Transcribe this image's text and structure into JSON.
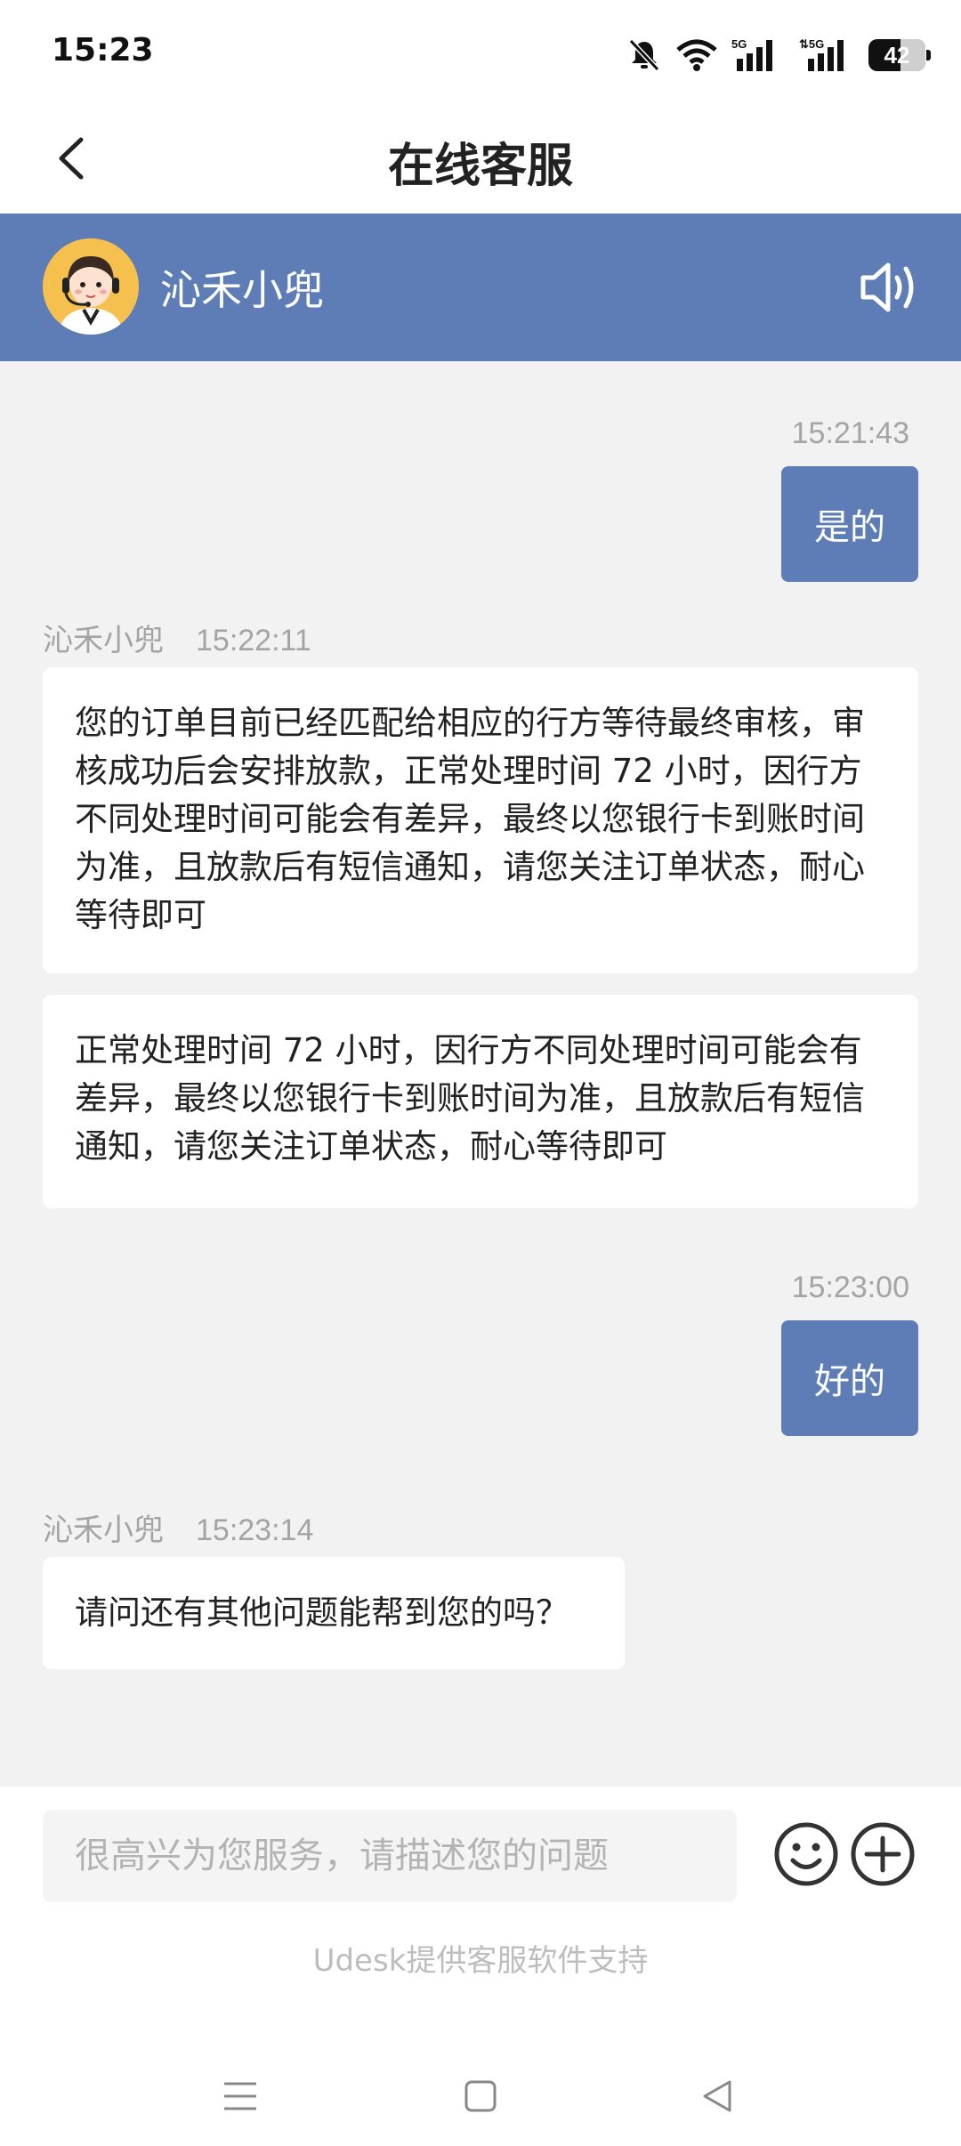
{
  "status_bar": {
    "time": "15:23",
    "battery": "42",
    "icons": [
      "mute-bell-icon",
      "wifi-icon",
      "5g-signal-icon",
      "5g-signal-icon",
      "battery-icon"
    ]
  },
  "header": {
    "title": "在线客服",
    "back_icon": "back-chevron-icon"
  },
  "agent": {
    "name": "沁禾小兜",
    "avatar_icon": "agent-avatar",
    "speaker_icon": "speaker-icon"
  },
  "messages": [
    {
      "direction": "out",
      "time": "15:21:43",
      "text": "是的"
    },
    {
      "direction": "in",
      "sender": "沁禾小兜",
      "time": "15:22:11",
      "text": "您的订单目前已经匹配给相应的行方等待最终审核，审核成功后会安排放款，正常处理时间 72 小时，因行方不同处理时间可能会有差异，最终以您银行卡到账时间为准，且放款后有短信通知，请您关注订单状态，耐心等待即可"
    },
    {
      "direction": "in",
      "text": "正常处理时间 72 小时，因行方不同处理时间可能会有差异，最终以您银行卡到账时间为准，且放款后有短信通知，请您关注订单状态，耐心等待即可"
    },
    {
      "direction": "out",
      "time": "15:23:00",
      "text": "好的"
    },
    {
      "direction": "in",
      "sender": "沁禾小兜",
      "time": "15:23:14",
      "text": "请问还有其他问题能帮到您的吗？"
    }
  ],
  "composer": {
    "placeholder": "很高兴为您服务，请描述您的问题",
    "value": "",
    "emoji_icon": "smile-icon",
    "plus_icon": "plus-circle-icon"
  },
  "footer": {
    "powered_by": "Udesk提供客服软件支持"
  },
  "nav": {
    "icons": [
      "menu-icon",
      "home-square-icon",
      "back-triangle-icon"
    ]
  },
  "colors": {
    "accent": "#5e7db6",
    "background": "#f2f2f2",
    "avatar_bg": "#f6c04e"
  }
}
